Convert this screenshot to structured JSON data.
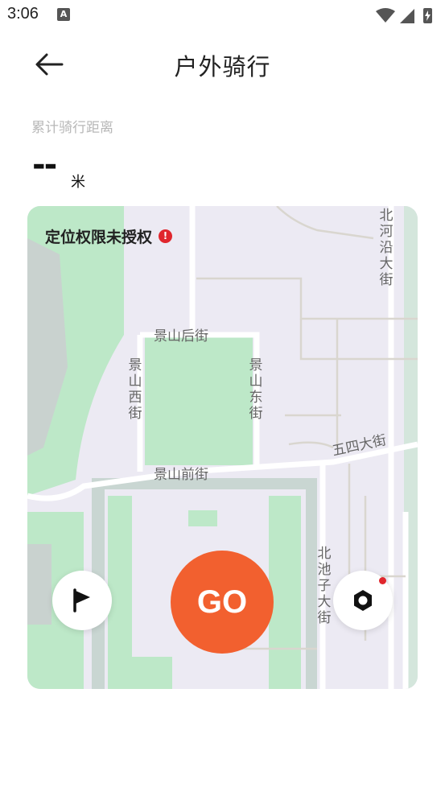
{
  "status_bar": {
    "time": "3:06",
    "notif_icon": "A"
  },
  "header": {
    "title": "户外骑行"
  },
  "distance": {
    "label": "累计骑行距离",
    "value": "--",
    "unit": "米"
  },
  "map": {
    "permission_text": "定位权限未授权",
    "permission_icon": "!",
    "streets": {
      "jingshan_hou": "景山后街",
      "jingshan_xi": "景山西街",
      "jingshan_dong": "景山东街",
      "jingshan_qian": "景山前街",
      "wusi": "五四大街",
      "beiheyan": "北河沿大街",
      "beichizi": "北池子大街"
    }
  },
  "controls": {
    "go_label": "GO"
  },
  "colors": {
    "accent": "#f2602f",
    "green": "#bde8c8",
    "warn": "#e0262d"
  }
}
